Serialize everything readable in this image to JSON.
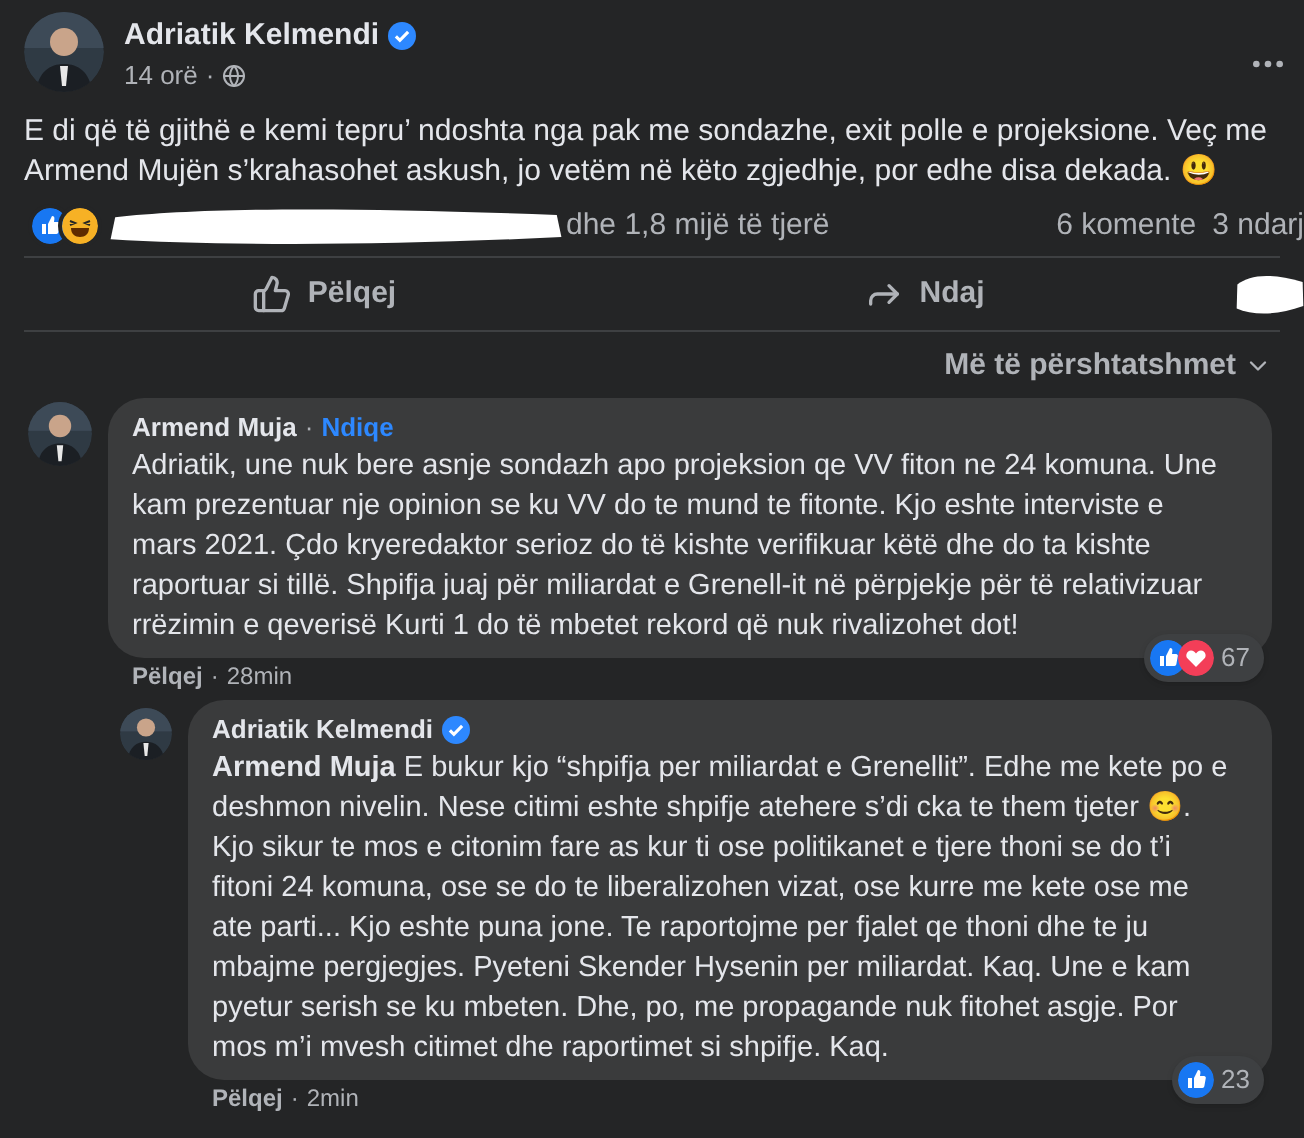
{
  "post": {
    "author": "Adriatik Kelmendi",
    "verified": true,
    "time": "14 orë",
    "time_separator": "·",
    "text": "E di që të gjithë e kemi tepru’ ndoshta nga pak me sondazhe, exit polle e projeksione. Veç me Armend Mujën s’krahasohet askush, jo vetëm në këto zgjedhje, por edhe disa dekada. 😃",
    "reactions_summary": "dhe 1,8 mijë të tjerë",
    "comments_count": "6 komente",
    "shares_count": "3 ndarj"
  },
  "actions": [
    {
      "label": "Pëlqej",
      "kind": "like"
    },
    {
      "label": "Ndaj",
      "kind": "share"
    }
  ],
  "sort": "Më të përshtatshmet",
  "comments": [
    {
      "author": "Armend Muja",
      "verified": false,
      "follow_separator": "·",
      "follow": "Ndiqe",
      "reply": false,
      "text": "Adriatik, une nuk bere asnje sondazh apo projeksion qe VV fiton ne 24 komuna. Une kam prezentuar nje opinion se ku VV do te mund te fitonte. Kjo eshte interviste e mars 2021. Çdo kryeredaktor serioz do të kishte verifikuar këtë dhe do ta kishte raportuar si tillë. Shpifja juaj për miliardat e Grenell-it në përpjekje për të relativizuar rrëzimin e qeverisë Kurti 1 do të mbetet rekord që nuk rivalizohet dot!",
      "like_label": "Pëlqej",
      "meta_separator": "·",
      "time": "28min",
      "loved": true,
      "reaction_count": "67"
    },
    {
      "author": "Adriatik Kelmendi",
      "verified": true,
      "reply": true,
      "text": "**Armend Muja** E bukur kjo “shpifja per miliardat e Grenellit”. Edhe me kete po e deshmon nivelin. Nese citimi eshte shpifje atehere s’di cka te them tjeter 😊. Kjo sikur te mos e citonim fare as kur ti ose politikanet e tjere thoni se do t’i fitoni 24 komuna, ose se do te liberalizohen vizat, ose kurre me kete ose me ate parti... Kjo eshte puna jone. Te raportojme per fjalet qe thoni dhe te ju mbajme pergjegjes. Pyeteni Skender Hysenin per miliardat. Kaq. Une e kam pyetur serish se ku mbeten. Dhe, po, me propagande nuk fitohet asgje. Por mos m’i mvesh citimet dhe raportimet si shpifje. Kaq.",
      "like_label": "Pëlqej",
      "meta_separator": "·",
      "time": "2min",
      "loved": false,
      "reaction_count": "23"
    }
  ]
}
